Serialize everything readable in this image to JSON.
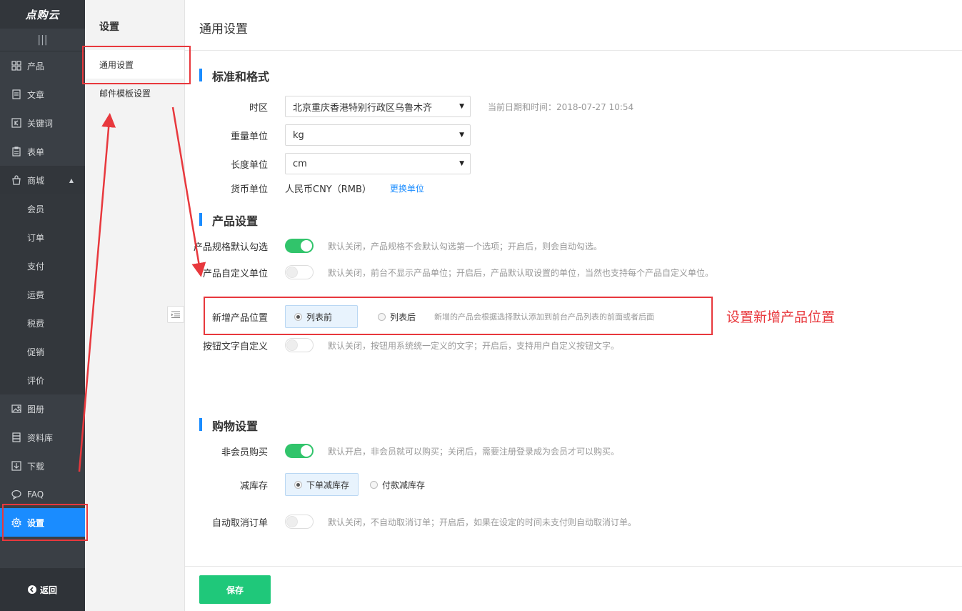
{
  "sidebar": {
    "logo": "点购云",
    "collapse_glyph": "|||",
    "items": [
      {
        "label": "产品",
        "icon": "grid-icon"
      },
      {
        "label": "文章",
        "icon": "document-icon"
      },
      {
        "label": "关键词",
        "icon": "keyword-icon"
      },
      {
        "label": "表单",
        "icon": "clipboard-icon"
      },
      {
        "label": "商城",
        "icon": "shop-icon"
      },
      {
        "label": "会员"
      },
      {
        "label": "订单"
      },
      {
        "label": "支付"
      },
      {
        "label": "运费"
      },
      {
        "label": "税费"
      },
      {
        "label": "促销"
      },
      {
        "label": "评价"
      },
      {
        "label": "图册",
        "icon": "image-icon"
      },
      {
        "label": "资料库",
        "icon": "database-icon"
      },
      {
        "label": "下载",
        "icon": "download-icon"
      },
      {
        "label": "FAQ",
        "icon": "chat-icon"
      },
      {
        "label": "设置",
        "icon": "gear-icon"
      }
    ],
    "back_label": "返回"
  },
  "subnav": {
    "title": "设置",
    "items": [
      "通用设置",
      "邮件模板设置"
    ]
  },
  "page": {
    "title": "通用设置",
    "section_standard": "标准和格式",
    "timezone_label": "时区",
    "timezone_value": "北京重庆香港特别行政区乌鲁木齐",
    "current_time": "当前日期和时间：2018-07-27 10:54",
    "weight_label": "重量单位",
    "weight_value": "kg",
    "length_label": "长度单位",
    "length_value": "cm",
    "currency_label": "货币单位",
    "currency_value": "人民币CNY（RMB）",
    "change_unit": "更换单位",
    "section_product": "产品设置",
    "spec_label": "产品规格默认勾选",
    "spec_hint": "默认关闭，产品规格不会默认勾选第一个选项；开启后，则会自动勾选。",
    "unit_label": "产品自定义单位",
    "unit_hint": "默认关闭，前台不显示产品单位；开启后，产品默认取设置的单位，当然也支持每个产品自定义单位。",
    "position_label": "新增产品位置",
    "position_opt1": "列表前",
    "position_opt2": "列表后",
    "position_hint": "新增的产品会根据选择默认添加到前台产品列表的前面或者后面",
    "btn_text_label": "按钮文字自定义",
    "btn_text_hint": "默认关闭，按钮用系统统一定义的文字；开启后，支持用户自定义按钮文字。",
    "section_shopping": "购物设置",
    "guest_label": "非会员购买",
    "guest_hint": "默认开启，非会员就可以购买；关闭后，需要注册登录成为会员才可以购买。",
    "stock_label": "减库存",
    "stock_opt1": "下单减库存",
    "stock_opt2": "付款减库存",
    "auto_cancel_label": "自动取消订单",
    "auto_cancel_hint": "默认关闭，不自动取消订单；开启后，如果在设定的时间未支付则自动取消订单。",
    "save_label": "保存"
  },
  "annotation": {
    "text": "设置新增产品位置",
    "color": "#e8383d"
  },
  "colors": {
    "accent": "#1a8cff",
    "switch_on": "#31c46b",
    "save": "#1fc87a"
  }
}
